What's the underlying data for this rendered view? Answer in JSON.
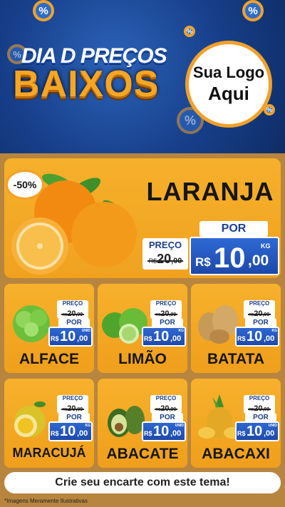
{
  "header": {
    "title_line1": "DIA D PREÇOS",
    "title_line2": "BAIXOS",
    "logo_line1": "Sua Logo",
    "logo_line2": "Aqui",
    "pct_symbol": "%"
  },
  "featured": {
    "discount": "-50%",
    "name": "LARANJA",
    "price_label": "PREÇO",
    "old_currency": "R$",
    "old_int": "20",
    "old_dec": ",00",
    "por_label": "POR",
    "currency": "R$",
    "new_int": "10",
    "new_dec": ",00",
    "unit": "KG"
  },
  "products": [
    {
      "name": "ALFACE",
      "price_label": "PREÇO",
      "old_currency": "R$",
      "old_int": "20",
      "old_dec": ",00",
      "por_label": "POR",
      "currency": "R$",
      "new_int": "10",
      "new_dec": ",00",
      "unit": "UNID"
    },
    {
      "name": "LIMÃO",
      "price_label": "PREÇO",
      "old_currency": "R$",
      "old_int": "20",
      "old_dec": ",00",
      "por_label": "POR",
      "currency": "R$",
      "new_int": "10",
      "new_dec": ",00",
      "unit": "KG"
    },
    {
      "name": "BATATA",
      "price_label": "PREÇO",
      "old_currency": "R$",
      "old_int": "20",
      "old_dec": ",00",
      "por_label": "POR",
      "currency": "R$",
      "new_int": "10",
      "new_dec": ",00",
      "unit": "KG"
    },
    {
      "name": "MARACUJÁ",
      "price_label": "PREÇO",
      "old_currency": "R$",
      "old_int": "20",
      "old_dec": ",00",
      "por_label": "POR",
      "currency": "R$",
      "new_int": "10",
      "new_dec": ",00",
      "unit": "KG"
    },
    {
      "name": "ABACATE",
      "price_label": "PREÇO",
      "old_currency": "R$",
      "old_int": "20",
      "old_dec": ",00",
      "por_label": "POR",
      "currency": "R$",
      "new_int": "10",
      "new_dec": ",00",
      "unit": "UNID"
    },
    {
      "name": "ABACAXI",
      "price_label": "PREÇO",
      "old_currency": "R$",
      "old_int": "20",
      "old_dec": ",00",
      "por_label": "POR",
      "currency": "R$",
      "new_int": "10",
      "new_dec": ",00",
      "unit": "UNID"
    }
  ],
  "footer": {
    "cta": "Crie seu encarte com este tema!",
    "disclaimer": "*Imagens Meramente Ilustrativas"
  },
  "colors": {
    "orange": "#f2a12a",
    "blue": "#1c47a8",
    "navy": "#0f2d66"
  }
}
